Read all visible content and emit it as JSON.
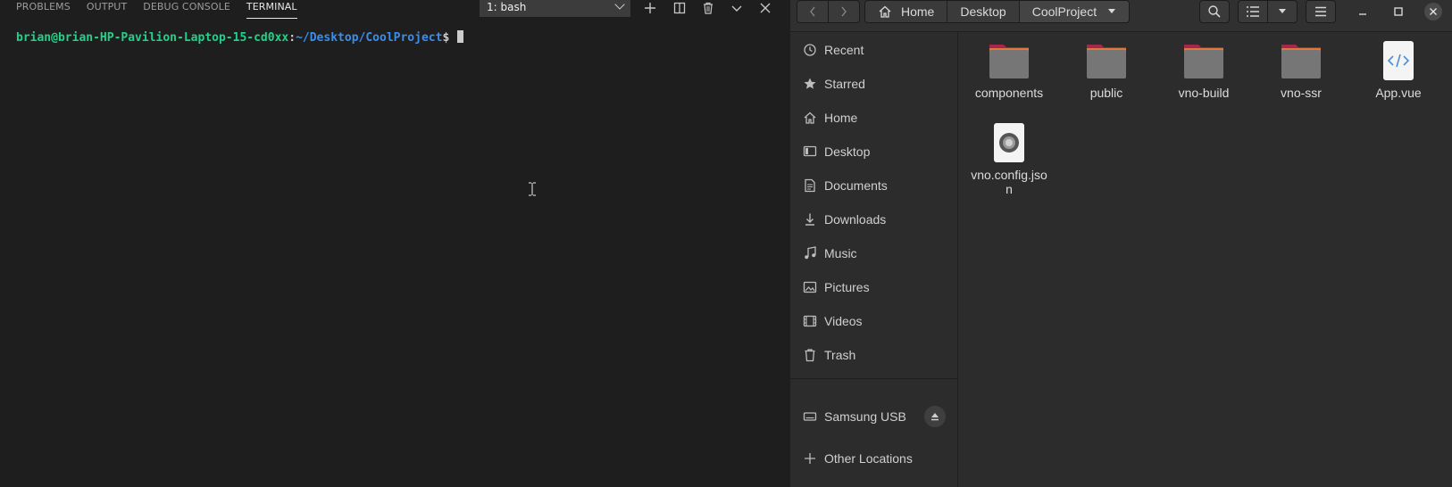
{
  "vscode": {
    "panel_tabs": [
      "PROBLEMS",
      "OUTPUT",
      "DEBUG CONSOLE",
      "TERMINAL"
    ],
    "active_tab": "TERMINAL",
    "terminal_select": "1: bash",
    "toolbar_icons": [
      "plus-icon",
      "split-icon",
      "trash-icon",
      "chevron-down-icon",
      "close-icon"
    ],
    "prompt": {
      "user_host": "brian@brian-HP-Pavilion-Laptop-15-cd0xx",
      "colon": ":",
      "path": "~/Desktop/CoolProject",
      "dollar": "$ "
    }
  },
  "files": {
    "breadcrumbs": [
      "Home",
      "Desktop",
      "CoolProject"
    ],
    "sidebar": {
      "places": [
        {
          "label": "Recent",
          "icon": "clock-icon"
        },
        {
          "label": "Starred",
          "icon": "star-icon"
        },
        {
          "label": "Home",
          "icon": "home-icon"
        },
        {
          "label": "Desktop",
          "icon": "desktop-icon"
        },
        {
          "label": "Documents",
          "icon": "document-icon"
        },
        {
          "label": "Downloads",
          "icon": "download-icon"
        },
        {
          "label": "Music",
          "icon": "music-icon"
        },
        {
          "label": "Pictures",
          "icon": "picture-icon"
        },
        {
          "label": "Videos",
          "icon": "video-icon"
        },
        {
          "label": "Trash",
          "icon": "trash-icon"
        }
      ],
      "devices": [
        {
          "label": "Samsung USB",
          "icon": "drive-icon"
        }
      ],
      "other": {
        "label": "Other Locations",
        "icon": "plus-icon"
      }
    },
    "items": [
      {
        "name": "components",
        "type": "folder"
      },
      {
        "name": "public",
        "type": "folder"
      },
      {
        "name": "vno-build",
        "type": "folder"
      },
      {
        "name": "vno-ssr",
        "type": "folder"
      },
      {
        "name": "App.vue",
        "type": "code-file"
      },
      {
        "name": "vno.config.json",
        "type": "config-file"
      }
    ],
    "colors": {
      "folder_body": "#767676",
      "folder_tab": "#a3284e",
      "folder_strip": "#e6773c"
    }
  }
}
